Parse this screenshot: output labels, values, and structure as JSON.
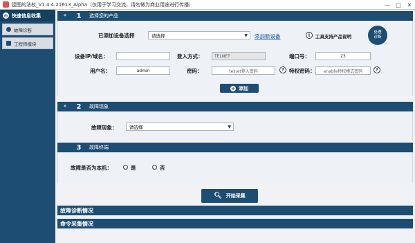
{
  "window": {
    "title": "捷图的法杖_V1.4.4.21613_Alpha（仅用于学习交流，请勿做为商业用途进行传播）",
    "minimize": "—",
    "maximize": "□",
    "close": "✕"
  },
  "sidebar": {
    "header": "快速信息收集",
    "header_icon": "⊖",
    "items": [
      {
        "label": "故障诊断"
      },
      {
        "label": "工程师模块"
      }
    ]
  },
  "section1": {
    "star": "*",
    "num": "1",
    "title": "选择您的产品",
    "added_label": "已添加设备选择",
    "select_value": "请选择",
    "add_link": "添加新设备",
    "info_icon": "i",
    "support_label": "工具支持产品说明",
    "diag_btn": "处理\n诊断",
    "ip_label": "设备IP/域名：",
    "ip_value": "",
    "login_label": "登入方式：",
    "login_value": "TELNET",
    "port_label": "端口号：",
    "port_value": "23",
    "user_label": "用户名：",
    "user_value": "admin",
    "pwd_label": "密码：",
    "pwd_placeholder": "telnet登入密码",
    "priv_label": "特权密码：",
    "priv_placeholder": "enable特权模式密码",
    "help": "?",
    "add_btn": "添加"
  },
  "section2": {
    "star": "*",
    "num": "2",
    "title": "故障现象",
    "label": "故障现象：",
    "select_value": "请选择"
  },
  "section3": {
    "num": "3",
    "title": "故障终端",
    "question": "故障是否为本机：",
    "yes": "是",
    "no": "否"
  },
  "start_btn": "开始采集",
  "diag_status": "故障诊断情况",
  "cmd_status": "命令采集情况"
}
